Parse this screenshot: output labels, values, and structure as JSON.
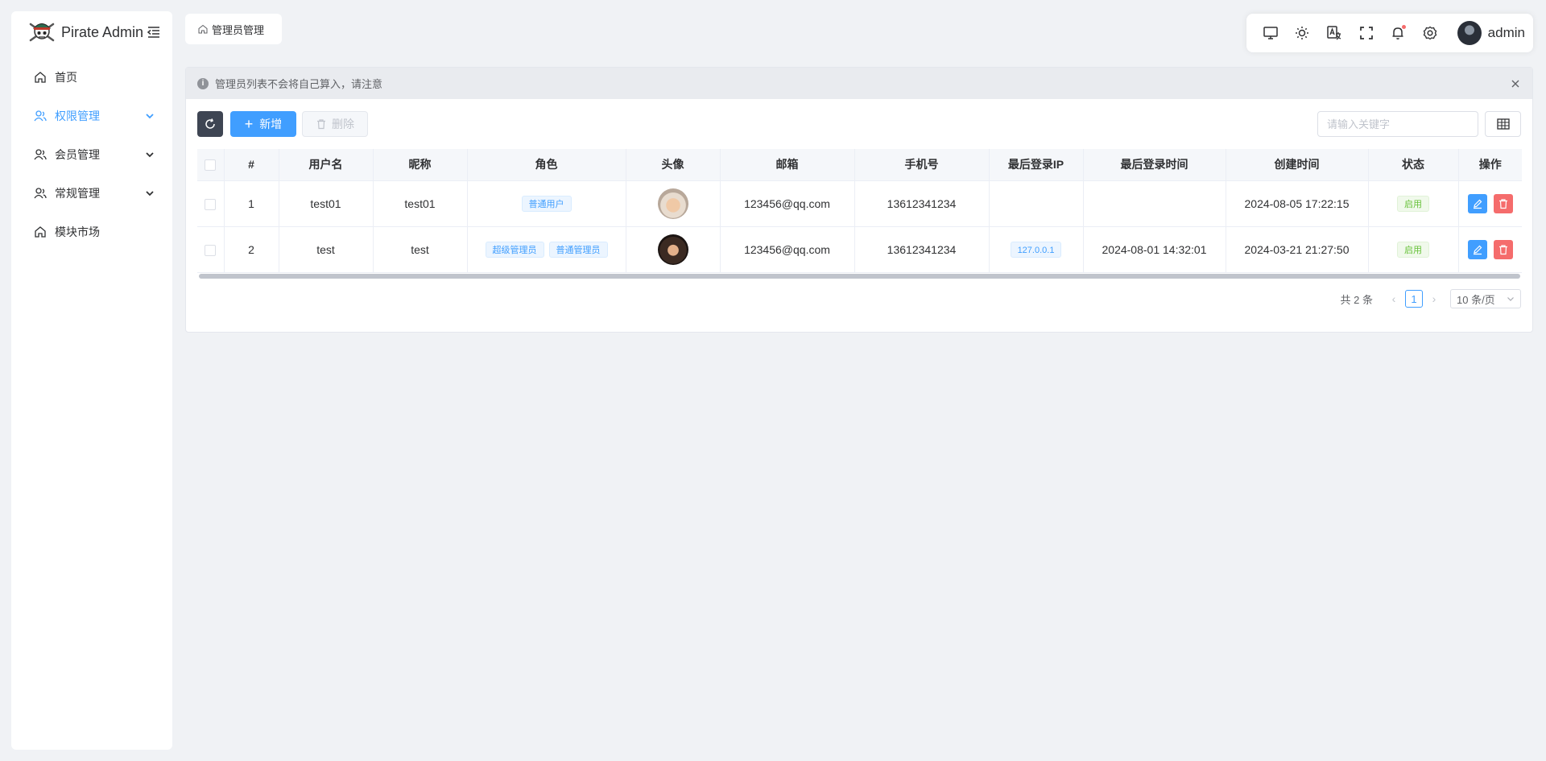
{
  "app": {
    "title": "Pirate Admin"
  },
  "sidebar": {
    "items": [
      {
        "label": "首页",
        "icon": "home-icon",
        "active": false,
        "expandable": false
      },
      {
        "label": "权限管理",
        "icon": "users-icon",
        "active": true,
        "expandable": true
      },
      {
        "label": "会员管理",
        "icon": "users-icon",
        "active": false,
        "expandable": true
      },
      {
        "label": "常规管理",
        "icon": "users-icon",
        "active": false,
        "expandable": true
      },
      {
        "label": "模块市场",
        "icon": "home-icon",
        "active": false,
        "expandable": false
      }
    ]
  },
  "tabs": [
    {
      "label": "管理员管理",
      "icon": "home-icon"
    }
  ],
  "header": {
    "user_name": "admin",
    "has_notification": true
  },
  "alert": {
    "text": "管理员列表不会将自己算入，请注意"
  },
  "toolbar": {
    "add_label": "新增",
    "delete_label": "删除",
    "search_placeholder": "请输入关键字"
  },
  "table": {
    "columns": [
      "#",
      "用户名",
      "昵称",
      "角色",
      "头像",
      "邮箱",
      "手机号",
      "最后登录IP",
      "最后登录时间",
      "创建时间",
      "状态",
      "操作"
    ],
    "rows": [
      {
        "index": "1",
        "username": "test01",
        "nickname": "test01",
        "roles": [
          "普通用户"
        ],
        "email": "123456@qq.com",
        "phone": "13612341234",
        "last_ip": "",
        "last_login": "",
        "created": "2024-08-05 17:22:15",
        "status": "启用"
      },
      {
        "index": "2",
        "username": "test",
        "nickname": "test",
        "roles": [
          "超级管理员",
          "普通管理员"
        ],
        "email": "123456@qq.com",
        "phone": "13612341234",
        "last_ip": "127.0.0.1",
        "last_login": "2024-08-01 14:32:01",
        "created": "2024-03-21 21:27:50",
        "status": "启用"
      }
    ]
  },
  "pagination": {
    "total": "共 2 条",
    "current_page": "1",
    "page_size": "10 条/页"
  },
  "colors": {
    "primary": "#409eff",
    "danger": "#f56c6c",
    "success": "#67c23a",
    "refresh_bg": "#3e4553"
  }
}
